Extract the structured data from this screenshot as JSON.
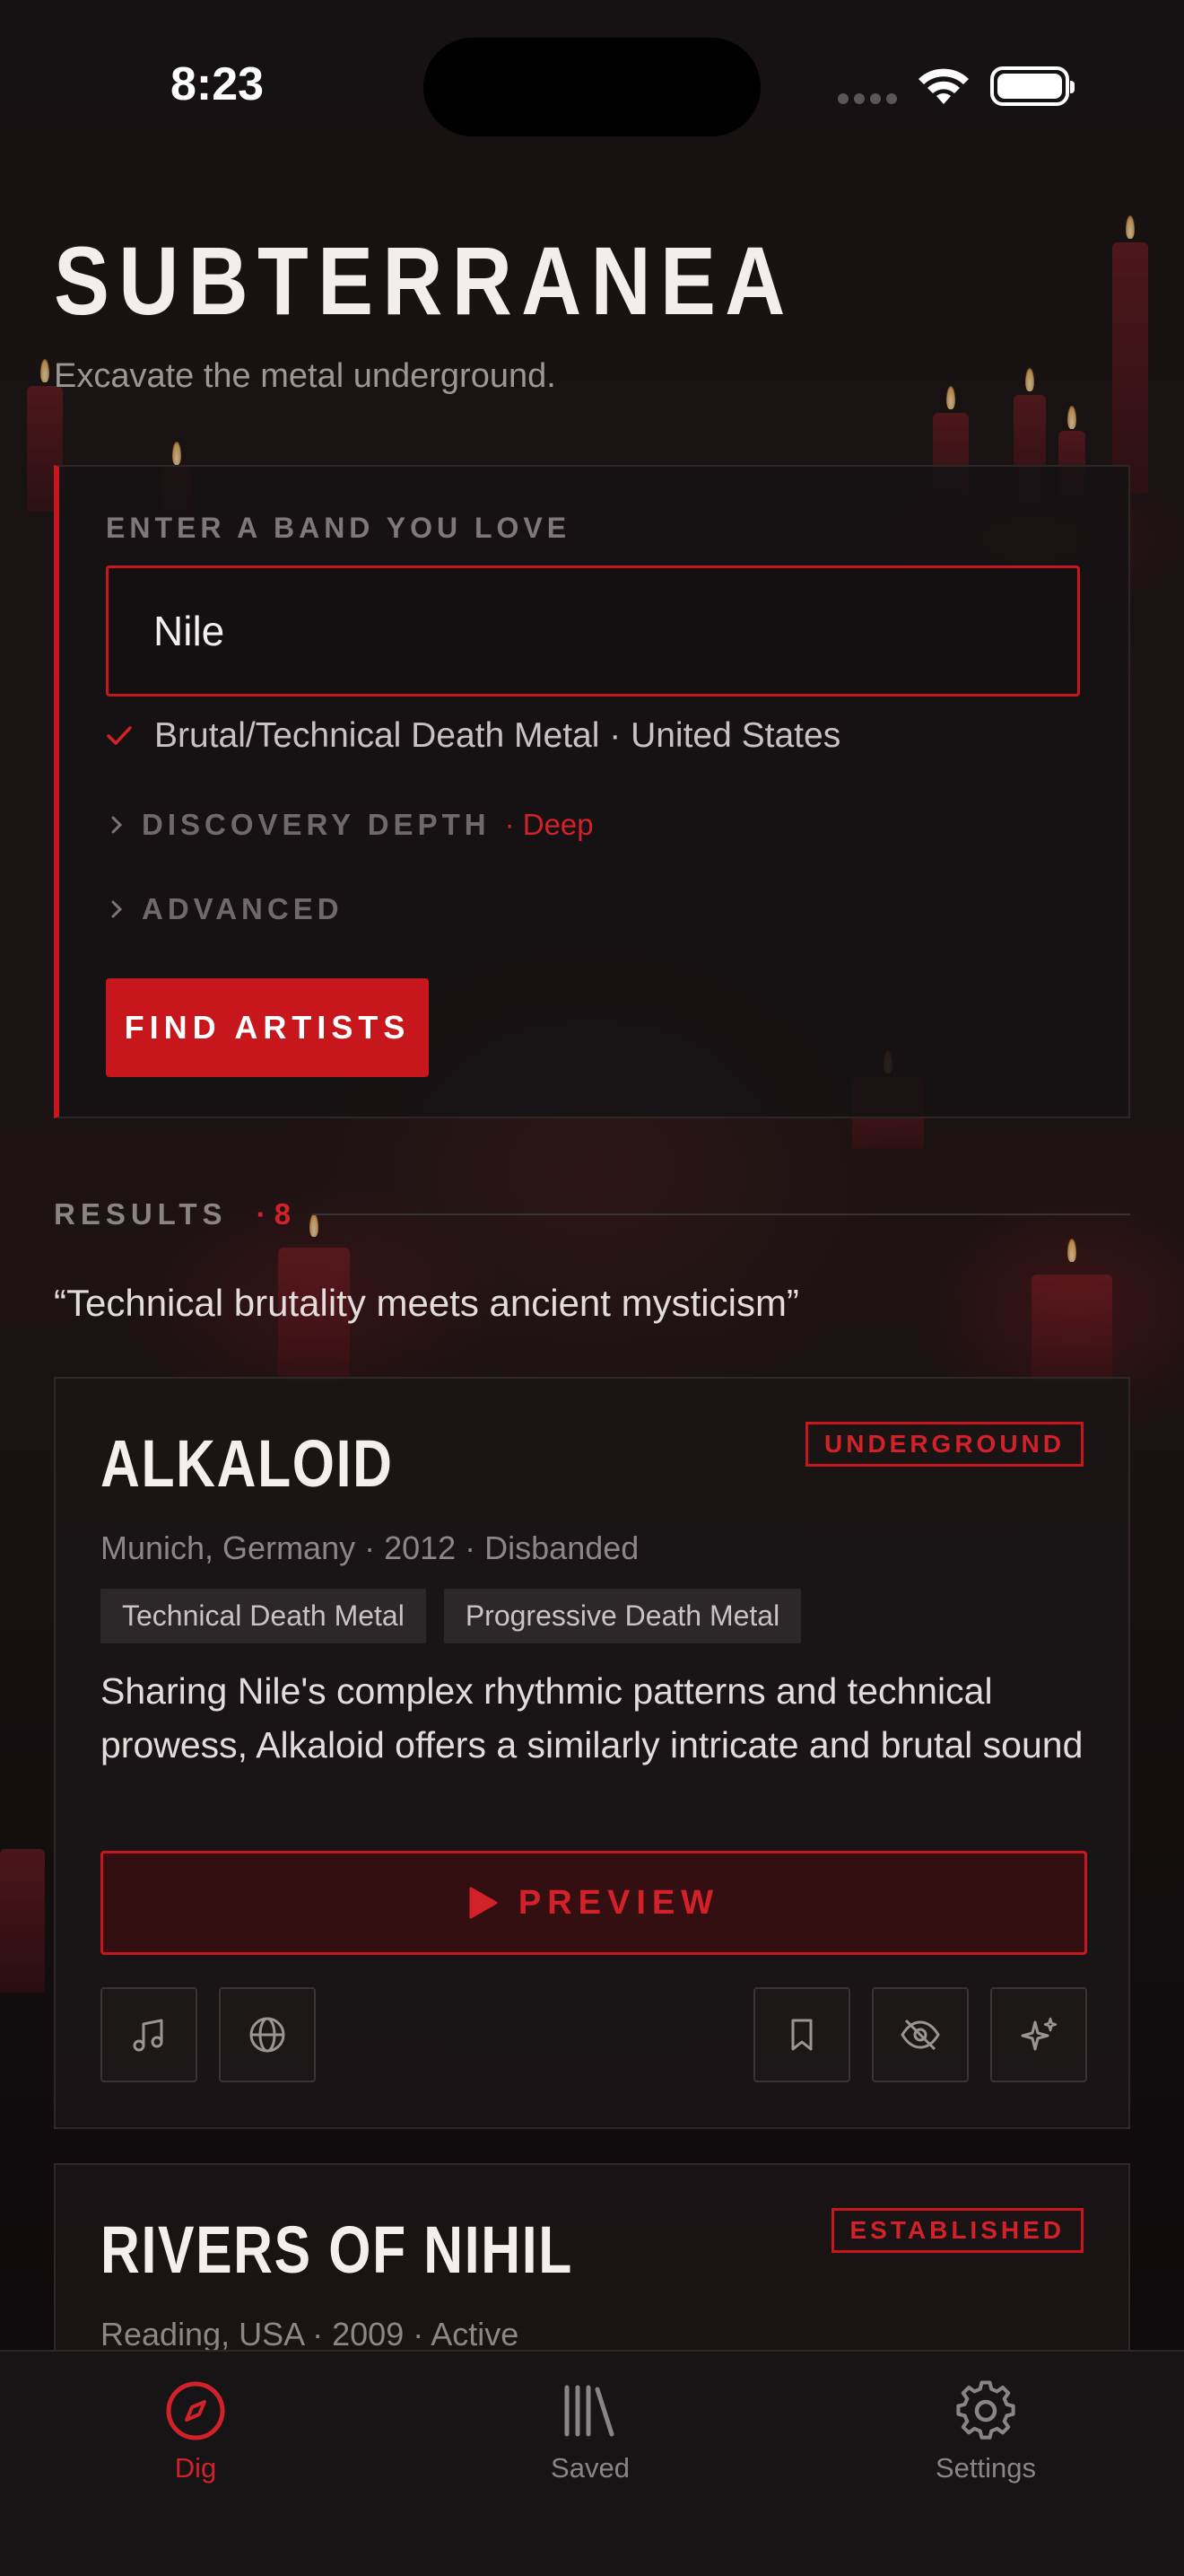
{
  "status_bar": {
    "time": "8:23"
  },
  "app": {
    "title": "SUBTERRANEA",
    "subtitle": "Excavate the metal underground."
  },
  "search": {
    "label": "ENTER A BAND YOU LOVE",
    "input_value": "Nile",
    "match_text": "Brutal/Technical Death Metal · United States",
    "discovery_depth_label": "DISCOVERY DEPTH",
    "discovery_depth_value": "· Deep",
    "advanced_label": "ADVANCED",
    "find_button": "FIND ARTISTS"
  },
  "results": {
    "label": "RESULTS",
    "count": "· 8",
    "tagline": "“Technical brutality meets ancient mysticism”"
  },
  "cards": [
    {
      "name": "ALKALOID",
      "badge": "UNDERGROUND",
      "meta": "Munich, Germany · 2012 · Disbanded",
      "genres": [
        "Technical Death Metal",
        "Progressive Death Metal"
      ],
      "description": "Sharing Nile's complex rhythmic patterns and technical prowess, Alkaloid offers a similarly intricate and brutal sound",
      "preview_label": "PREVIEW"
    },
    {
      "name": "RIVERS OF NIHIL",
      "badge": "ESTABLISHED",
      "meta": "Reading, USA · 2009 · Active"
    }
  ],
  "tabbar": {
    "tabs": [
      {
        "label": "Dig",
        "icon": "compass-icon",
        "active": true
      },
      {
        "label": "Saved",
        "icon": "library-icon",
        "active": false
      },
      {
        "label": "Settings",
        "icon": "gear-icon",
        "active": false
      }
    ]
  },
  "colors": {
    "accent": "#c8161d",
    "background": "#0f0c0d",
    "panel": "#161213",
    "muted_text": "#8c8687"
  }
}
